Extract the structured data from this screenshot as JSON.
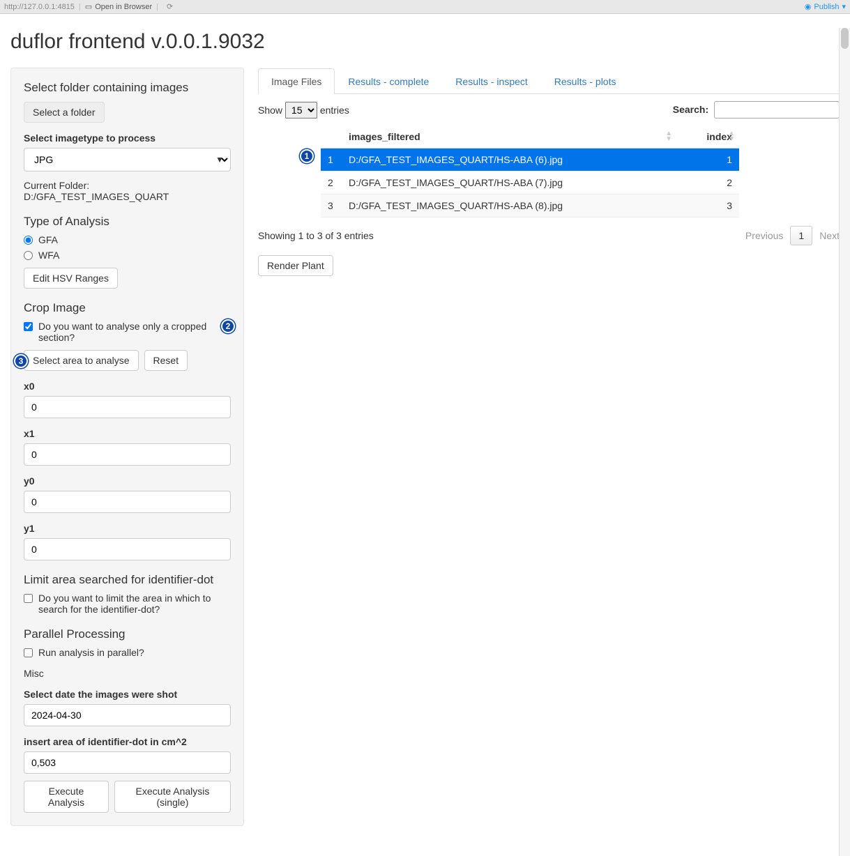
{
  "browser": {
    "url": "http://127.0.0.1:4815",
    "open": "Open in Browser",
    "publish": "Publish"
  },
  "app_title": "duflor frontend v.0.0.1.9032",
  "sidebar": {
    "folder_head": "Select folder containing images",
    "select_folder_btn": "Select a folder",
    "imagetype_label": "Select imagetype to process",
    "imagetype_value": "JPG",
    "current_folder_label": "Current Folder:",
    "current_folder_value": "D:/GFA_TEST_IMAGES_QUART",
    "analysis_head": "Type of Analysis",
    "radio_gfa": "GFA",
    "radio_wfa": "WFA",
    "edit_hsv_btn": "Edit HSV Ranges",
    "crop_head": "Crop Image",
    "crop_check_label": "Do you want to analyse only a cropped section?",
    "select_area_btn": "Select area to analyse",
    "reset_btn": "Reset",
    "x0_label": "x0",
    "x0_value": "0",
    "x1_label": "x1",
    "x1_value": "0",
    "y0_label": "y0",
    "y0_value": "0",
    "y1_label": "y1",
    "y1_value": "0",
    "limit_head": "Limit area searched for identifier-dot",
    "limit_check_label": "Do you want to limit the area in which to search for the identifier-dot?",
    "parallel_head": "Parallel Processing",
    "parallel_check_label": "Run analysis in parallel?",
    "misc_head": "Misc",
    "date_label": "Select date the images were shot",
    "date_value": "2024-04-30",
    "area_label": "insert area of identifier-dot in cm^2",
    "area_value": "0,503",
    "exec_btn": "Execute Analysis",
    "exec_single_btn": "Execute Analysis (single)"
  },
  "tabs": {
    "t1": "Image Files",
    "t2": "Results - complete",
    "t3": "Results - inspect",
    "t4": "Results - plots"
  },
  "datatable": {
    "show_label": "Show",
    "entries_label": "entries",
    "length_value": "15",
    "search_label": "Search:",
    "col_images": "images_filtered",
    "col_index": "index",
    "rows": [
      {
        "n": "1",
        "path": "D:/GFA_TEST_IMAGES_QUART/HS-ABA (6).jpg",
        "idx": "1"
      },
      {
        "n": "2",
        "path": "D:/GFA_TEST_IMAGES_QUART/HS-ABA (7).jpg",
        "idx": "2"
      },
      {
        "n": "3",
        "path": "D:/GFA_TEST_IMAGES_QUART/HS-ABA (8).jpg",
        "idx": "3"
      }
    ],
    "info": "Showing 1 to 3 of 3 entries",
    "prev": "Previous",
    "page1": "1",
    "next": "Next",
    "render_btn": "Render Plant"
  }
}
